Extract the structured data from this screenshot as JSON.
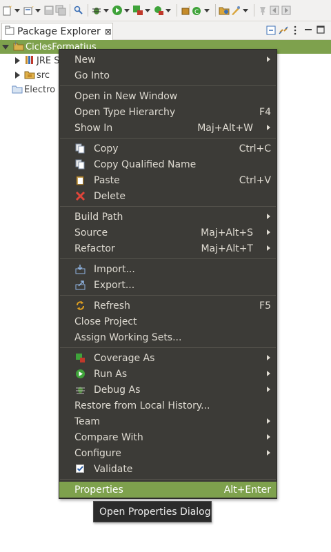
{
  "toolbar": {
    "icons": [
      "new-icon",
      "new-project-icon",
      "save-icon",
      "save-all-icon",
      "search-icon",
      "debug-icon",
      "run-icon",
      "coverage-icon",
      "external-tools-icon",
      "new-java-package-icon",
      "new-class-icon",
      "open-type-icon",
      "open-task-icon",
      "pin-icon",
      "back-icon",
      "forward-icon"
    ]
  },
  "view": {
    "tab_label": "Package Explorer",
    "close_glyph": "⊠"
  },
  "tree": {
    "project": "CiclesFormatius",
    "jre": "JRE S",
    "src": "src",
    "other_project": "Electro"
  },
  "menu": {
    "new": "New",
    "go_into": "Go Into",
    "open_new_window": "Open in New Window",
    "open_type_hierarchy": "Open Type Hierarchy",
    "open_type_hierarchy_acc": "F4",
    "show_in": "Show In",
    "show_in_acc": "Maj+Alt+W",
    "copy": "Copy",
    "copy_acc": "Ctrl+C",
    "copy_qualified": "Copy Qualified Name",
    "paste": "Paste",
    "paste_acc": "Ctrl+V",
    "delete": "Delete",
    "build_path": "Build Path",
    "source": "Source",
    "source_acc": "Maj+Alt+S",
    "refactor": "Refactor",
    "refactor_acc": "Maj+Alt+T",
    "import": "Import...",
    "export": "Export...",
    "refresh": "Refresh",
    "refresh_acc": "F5",
    "close_project": "Close Project",
    "assign_working_sets": "Assign Working Sets...",
    "coverage_as": "Coverage As",
    "run_as": "Run As",
    "debug_as": "Debug As",
    "restore_history": "Restore from Local History...",
    "team": "Team",
    "compare_with": "Compare With",
    "configure": "Configure",
    "validate": "Validate",
    "properties": "Properties",
    "properties_acc": "Alt+Enter"
  },
  "tooltip": "Open Properties Dialog",
  "colors": {
    "menu_bg": "#3c3b37",
    "highlight": "#7ea14d",
    "menu_text": "#dfdbd2"
  }
}
